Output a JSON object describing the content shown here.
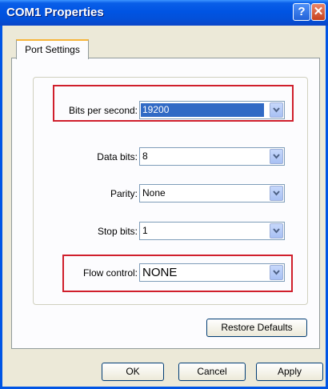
{
  "window": {
    "title": "COM1 Properties"
  },
  "titlebar_buttons": {
    "help": "?",
    "close": "✕"
  },
  "tabs": [
    {
      "label": "Port Settings"
    }
  ],
  "fields": {
    "bits_per_second": {
      "label": "Bits per second:",
      "value": "19200"
    },
    "data_bits": {
      "label": "Data bits:",
      "value": "8"
    },
    "parity": {
      "label": "Parity:",
      "value": "None"
    },
    "stop_bits": {
      "label": "Stop bits:",
      "value": "1"
    },
    "flow_control": {
      "label": "Flow control:",
      "value": "NONE"
    }
  },
  "buttons": {
    "restore_defaults": "Restore Defaults",
    "ok": "OK",
    "cancel": "Cancel",
    "apply": "Apply"
  },
  "colors": {
    "highlight_box": "#d01f2c",
    "title_bar": "#0054e3",
    "selection": "#316ac5"
  },
  "icons": {
    "dropdown": "chevron-down-icon"
  }
}
